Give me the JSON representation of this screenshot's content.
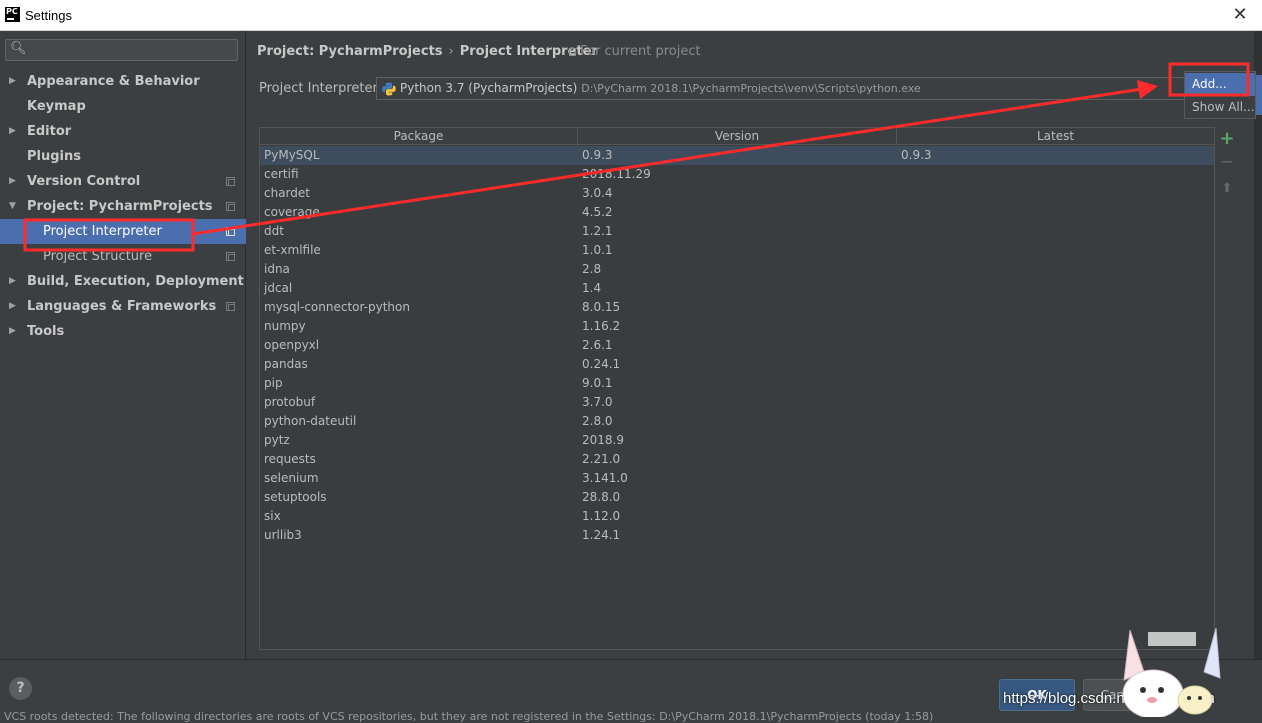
{
  "window": {
    "title": "Settings",
    "app_icon_text": "PC"
  },
  "sidebar": {
    "search_placeholder": "",
    "items": [
      {
        "label": "Appearance & Behavior",
        "expandable": true,
        "expanded": false
      },
      {
        "label": "Keymap",
        "expandable": false
      },
      {
        "label": "Editor",
        "expandable": true,
        "expanded": false
      },
      {
        "label": "Plugins",
        "expandable": false
      },
      {
        "label": "Version Control",
        "expandable": true,
        "expanded": false
      },
      {
        "label": "Project: PycharmProjects",
        "expandable": true,
        "expanded": true
      },
      {
        "label": "Project Interpreter",
        "child": true,
        "selected": true
      },
      {
        "label": "Project Structure",
        "child": true
      },
      {
        "label": "Build, Execution, Deployment",
        "expandable": true,
        "expanded": false
      },
      {
        "label": "Languages & Frameworks",
        "expandable": true,
        "expanded": false
      },
      {
        "label": "Tools",
        "expandable": true,
        "expanded": false
      }
    ]
  },
  "header": {
    "breadcrumb": [
      "Project: PycharmProjects",
      "Project Interpreter"
    ],
    "scope_note": "For current project"
  },
  "interpreter": {
    "label": "Project Interpreter:",
    "name": "Python 3.7 (PycharmProjects)",
    "path": "D:\\PyCharm 2018.1\\PycharmProjects\\venv\\Scripts\\python.exe"
  },
  "gear_menu": {
    "items": [
      "Add...",
      "Show All..."
    ]
  },
  "packages": {
    "columns": [
      "Package",
      "Version",
      "Latest"
    ],
    "rows": [
      {
        "package": "PyMySQL",
        "version": "0.9.3",
        "latest": "0.9.3"
      },
      {
        "package": "certifi",
        "version": "2018.11.29",
        "latest": ""
      },
      {
        "package": "chardet",
        "version": "3.0.4",
        "latest": ""
      },
      {
        "package": "coverage",
        "version": "4.5.2",
        "latest": ""
      },
      {
        "package": "ddt",
        "version": "1.2.1",
        "latest": ""
      },
      {
        "package": "et-xmlfile",
        "version": "1.0.1",
        "latest": ""
      },
      {
        "package": "idna",
        "version": "2.8",
        "latest": ""
      },
      {
        "package": "jdcal",
        "version": "1.4",
        "latest": ""
      },
      {
        "package": "mysql-connector-python",
        "version": "8.0.15",
        "latest": ""
      },
      {
        "package": "numpy",
        "version": "1.16.2",
        "latest": ""
      },
      {
        "package": "openpyxl",
        "version": "2.6.1",
        "latest": ""
      },
      {
        "package": "pandas",
        "version": "0.24.1",
        "latest": ""
      },
      {
        "package": "pip",
        "version": "9.0.1",
        "latest": ""
      },
      {
        "package": "protobuf",
        "version": "3.7.0",
        "latest": ""
      },
      {
        "package": "python-dateutil",
        "version": "2.8.0",
        "latest": ""
      },
      {
        "package": "pytz",
        "version": "2018.9",
        "latest": ""
      },
      {
        "package": "requests",
        "version": "2.21.0",
        "latest": ""
      },
      {
        "package": "selenium",
        "version": "3.141.0",
        "latest": ""
      },
      {
        "package": "setuptools",
        "version": "28.8.0",
        "latest": ""
      },
      {
        "package": "six",
        "version": "1.12.0",
        "latest": ""
      },
      {
        "package": "urllib3",
        "version": "1.24.1",
        "latest": ""
      }
    ]
  },
  "footer": {
    "help_label": "?",
    "ok_label": "OK",
    "cancel_label": "Cancel",
    "watermark": "https://blog.csdn.net/SSS_liuym",
    "status_text": "VCS roots detected: The following directories are roots of VCS repositories, but they are not registered in the Settings: D:\\PyCharm 2018.1\\PycharmProjects (today 1:58)"
  },
  "colors": {
    "background": "#3c3f41",
    "selection": "#4b6eaf",
    "annotation_red": "#ff2b2b",
    "add_green": "#59a869"
  }
}
